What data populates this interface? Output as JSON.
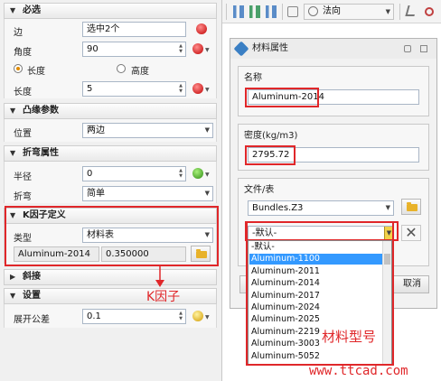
{
  "left_panel": {
    "required": {
      "title": "必选",
      "edge_label": "边",
      "edge_value": "选中2个",
      "angle_label": "角度",
      "angle_value": "90",
      "radio_length": "长度",
      "radio_height": "高度",
      "length_label": "长度",
      "length_value": "5"
    },
    "flange_params": {
      "title": "凸缘参数",
      "position_label": "位置",
      "position_value": "两边"
    },
    "bend_props": {
      "title": "折弯属性",
      "radius_label": "半径",
      "radius_value": "0",
      "bend_label": "折弯",
      "bend_value": "简单"
    },
    "k_factor": {
      "title": "K因子定义",
      "type_label": "类型",
      "type_value": "材料表",
      "material": "Aluminum-2014",
      "k_value": "0.350000"
    },
    "miter": {
      "title": "斜接"
    },
    "settings": {
      "title": "设置",
      "tolerance_label": "展开公差",
      "tolerance_value": "0.1"
    }
  },
  "toolbar": {
    "combo_value": "法向"
  },
  "dialog": {
    "title": "材料属性",
    "name_group": "名称",
    "name_value": "Aluminum-2014",
    "density_group": "密度(kg/m3)",
    "density_value": "2795.72",
    "file_group": "文件/表",
    "file_value": "Bundles.Z3",
    "table_value": "-默认-",
    "cancel_label": "取消"
  },
  "dropdown": {
    "items": [
      "-默认-",
      "Aluminum-1100",
      "Aluminum-2011",
      "Aluminum-2014",
      "Aluminum-2017",
      "Aluminum-2024",
      "Aluminum-2025",
      "Aluminum-2219",
      "Aluminum-3003",
      "Aluminum-5052"
    ],
    "selected_index": 1
  },
  "annotations": {
    "k_factor": "K因子",
    "material_type": "材料型号",
    "watermark": "www.ttcad.com"
  },
  "colors": {
    "annotation_red": "#e0272a",
    "selection_blue": "#3399ff"
  }
}
